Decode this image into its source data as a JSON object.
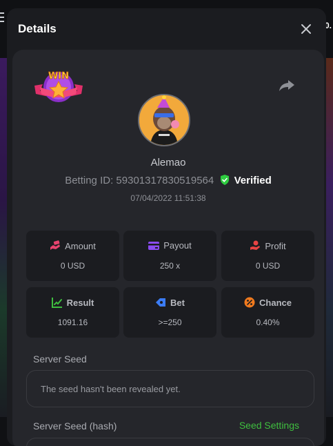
{
  "modal": {
    "title": "Details"
  },
  "background": {
    "right_text": "0."
  },
  "bet": {
    "username": "Alemao",
    "betting_id_label": "Betting ID:",
    "betting_id": "59301317830519564",
    "verified_label": "Verified",
    "timestamp": "07/04/2022 11:51:38",
    "badge_text": "WIN"
  },
  "stats": [
    {
      "label": "Amount",
      "value": "0 USD",
      "icon": "money-hand-icon",
      "color": "#e8436f"
    },
    {
      "label": "Payout",
      "value": "250 x",
      "icon": "wallet-card-icon",
      "color": "#8a4bf0"
    },
    {
      "label": "Profit",
      "value": "0 USD",
      "icon": "hand-coin-icon",
      "color": "#e84343"
    },
    {
      "label": "Result",
      "value": "1091.16",
      "icon": "chart-check-icon",
      "color": "#3fbf3f"
    },
    {
      "label": "Bet",
      "value": ">=250",
      "icon": "tag-icon",
      "color": "#3b7cf5"
    },
    {
      "label": "Chance",
      "value": "0.40%",
      "icon": "percent-icon",
      "color": "#f07a1e"
    }
  ],
  "server_seed": {
    "label": "Server Seed",
    "value": "The seed hasn't been revealed yet."
  },
  "server_seed_hash": {
    "label": "Server Seed (hash)",
    "seed_settings_label": "Seed Settings"
  }
}
